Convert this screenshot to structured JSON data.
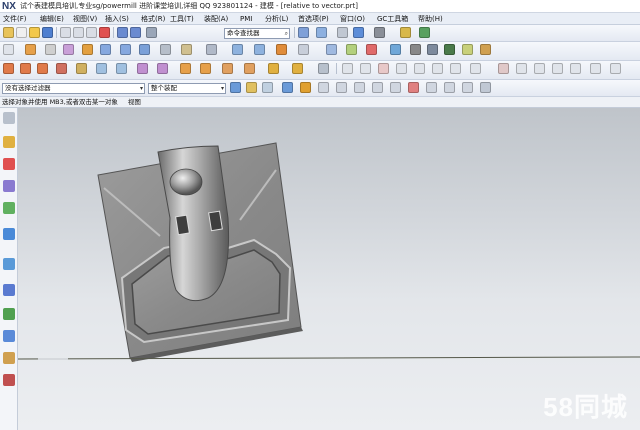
{
  "window": {
    "logo": "NX",
    "title": "试个表建模具培训,专业sg/powermill 进阶课堂培训,详细 QQ 923801124 - 建模 - [relative to vector.prt]"
  },
  "menubar": {
    "items": [
      "文件(F)",
      "编辑(E)",
      "视图(V)",
      "插入(S)",
      "格式(R)",
      "工具(T)",
      "装配(A)",
      "PMI",
      "分析(L)",
      "首选项(P)",
      "窗口(O)",
      "GC工具箱",
      "帮助(H)"
    ]
  },
  "toolbar3": {
    "selection_filter": "没有选择过滤器",
    "selection_scope": "整个装配"
  },
  "cuebar": {
    "prompt": "选择对象并使用 MB3,或者双击某一对象",
    "status": "视图"
  },
  "toolbar1": {
    "command_field": "命令查找器"
  },
  "watermark": {
    "text": "58同城"
  },
  "colors": {
    "viewport_top": "#bfc4ca",
    "viewport_bottom": "#eceef1",
    "part_body": "#8c8c8c",
    "part_highlight": "#d8d8d8"
  }
}
